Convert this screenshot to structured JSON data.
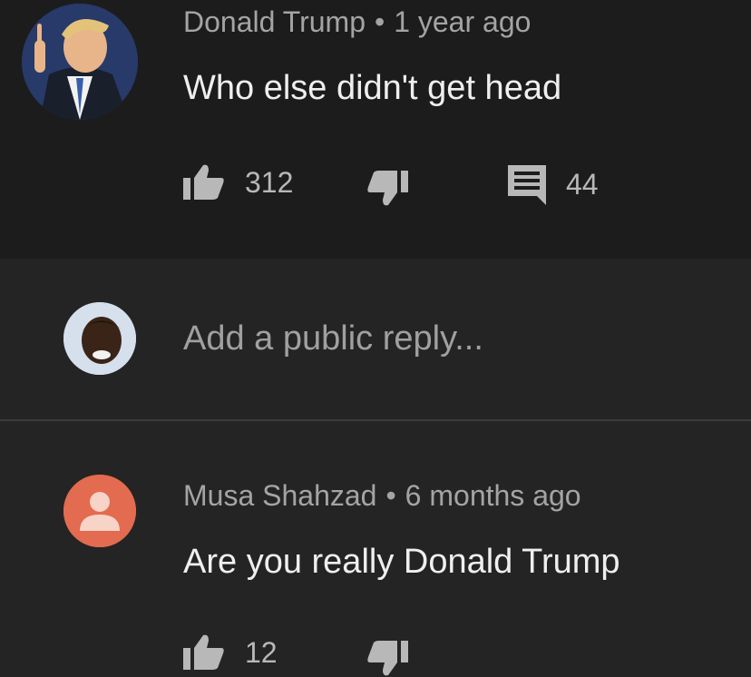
{
  "top_comment": {
    "author": "Donald Trump",
    "separator": "•",
    "time": "1 year ago",
    "text": "Who else didn't get head",
    "like_count": "312",
    "reply_count": "44"
  },
  "reply_box": {
    "placeholder": "Add a public reply..."
  },
  "reply_comment": {
    "author": "Musa Shahzad",
    "separator": "•",
    "time": "6 months ago",
    "text": "Are you really Donald Trump",
    "like_count": "12"
  },
  "icons": {
    "like": "thumbs-up-icon",
    "dislike": "thumbs-down-icon",
    "reply": "comment-icon",
    "default_avatar": "user-icon"
  },
  "colors": {
    "background": "#242424",
    "top_comment_background": "#1c1c1c",
    "default_avatar": "#e36b4f"
  }
}
